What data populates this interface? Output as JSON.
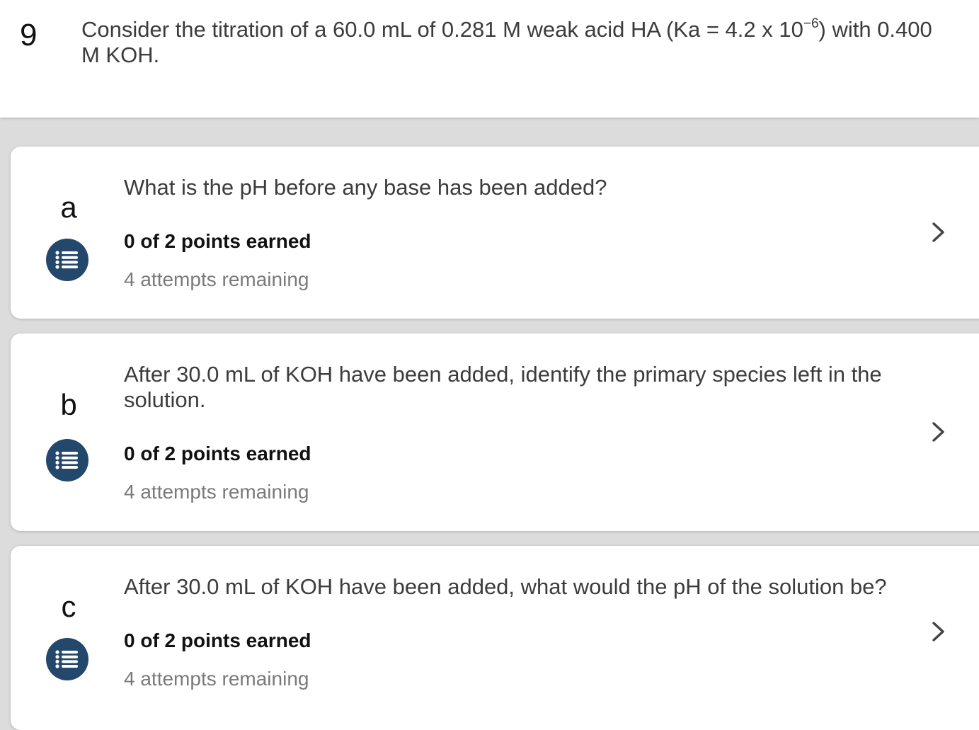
{
  "question": {
    "number": "9",
    "text_before_sup": "Consider the titration of a 60.0 mL of 0.281 M weak acid HA (Ka = 4.2 x 10",
    "sup": "−6",
    "text_after_sup": ") with 0.400 M KOH."
  },
  "parts": [
    {
      "letter": "a",
      "question": "What is the pH before any base has been added?",
      "points": "0 of 2 points earned",
      "attempts": "4 attempts remaining",
      "icon": "list-icon"
    },
    {
      "letter": "b",
      "question": "After 30.0 mL of KOH have been added, identify the primary species left in the solution.",
      "points": "0 of 2 points earned",
      "attempts": "4 attempts remaining",
      "icon": "list-icon"
    },
    {
      "letter": "c",
      "question": "After 30.0 mL of KOH have been added, what would the pH of the solution be?",
      "points": "0 of 2 points earned",
      "attempts": "4 attempts remaining",
      "icon": "list-icon"
    }
  ],
  "colors": {
    "icon_background": "#24486b",
    "page_background": "#dcdcdc",
    "card_background": "#ffffff",
    "attempts_text": "#7a7a7a"
  }
}
